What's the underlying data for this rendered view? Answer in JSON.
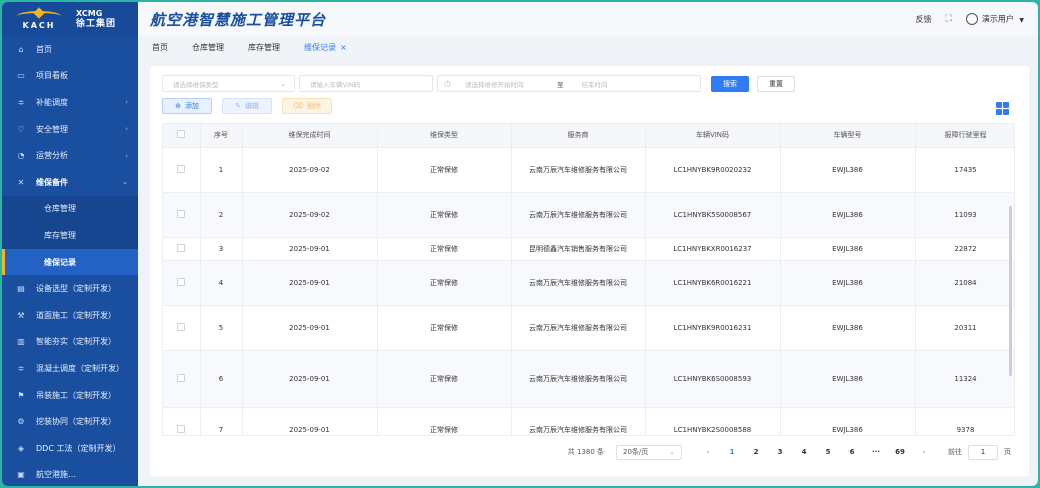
{
  "logo": {
    "left": "KACH",
    "right_en": "XCMG",
    "right_cn": "徐工集团"
  },
  "header": {
    "title": "航空港智慧施工管理平台",
    "feedback": "反馈",
    "fullscreen_icon": "⛶",
    "user": "演示用户"
  },
  "sidebar": {
    "items": [
      {
        "label": "首页",
        "icon": "⌂",
        "arrow": false
      },
      {
        "label": "项目看板",
        "icon": "▭",
        "arrow": false
      },
      {
        "label": "补能调度",
        "icon": "≑",
        "arrow": true
      },
      {
        "label": "安全管理",
        "icon": "♡",
        "arrow": true
      },
      {
        "label": "运营分析",
        "icon": "◔",
        "arrow": true
      },
      {
        "label": "维保备件",
        "icon": "✕",
        "arrow": true,
        "expanded": true
      },
      {
        "label": "仓库管理",
        "sub": true
      },
      {
        "label": "库存管理",
        "sub": true
      },
      {
        "label": "维保记录",
        "sub": true,
        "active": true
      },
      {
        "label": "设备选型（定制开发）",
        "icon": "▤"
      },
      {
        "label": "道面施工（定制开发）",
        "icon": "⚒"
      },
      {
        "label": "智能夯实（定制开发）",
        "icon": "▥"
      },
      {
        "label": "混凝土调度（定制开发）",
        "icon": "≑"
      },
      {
        "label": "吊装施工（定制开发）",
        "icon": "⚑"
      },
      {
        "label": "挖装协同（定制开发）",
        "icon": "⚙"
      },
      {
        "label": "DDC 工法（定制开发）",
        "icon": "◈"
      },
      {
        "label": "航空港施…",
        "icon": "▣"
      }
    ]
  },
  "tabs": [
    {
      "label": "首页"
    },
    {
      "label": "仓库管理"
    },
    {
      "label": "库存管理"
    },
    {
      "label": "维保记录",
      "active": true,
      "close": "×"
    }
  ],
  "filters": {
    "type_placeholder": "请选择维保类型",
    "vin_placeholder": "请输入车辆VIN码",
    "start_placeholder": "请选择维修开始时间",
    "range_sep": "至",
    "end_placeholder": "结束时间",
    "search": "搜索",
    "reset": "重置"
  },
  "actions": {
    "add": "添加",
    "edit": "编辑",
    "delete": "删除"
  },
  "table": {
    "columns": [
      "序号",
      "维保完成时间",
      "维保类型",
      "服务商",
      "车辆VIN码",
      "车辆型号",
      "报障行驶里程"
    ],
    "rows": [
      {
        "no": "1",
        "date": "2025-09-02",
        "type": "正常保修",
        "vendor": "云南万辰汽车维修服务有限公司",
        "vin": "LC1HNYBK9R0020232",
        "model": "EWJL386",
        "km": "17435"
      },
      {
        "no": "2",
        "date": "2025-09-02",
        "type": "正常保修",
        "vendor": "云南万辰汽车维修服务有限公司",
        "vin": "LC1HNYBK5S0008567",
        "model": "EWJL386",
        "km": "11093"
      },
      {
        "no": "3",
        "date": "2025-09-01",
        "type": "正常保修",
        "vendor": "昆明德鑫汽车销售服务有限公司",
        "vin": "LC1HNYBKXR0016237",
        "model": "EWJL386",
        "km": "22872"
      },
      {
        "no": "4",
        "date": "2025-09-01",
        "type": "正常保修",
        "vendor": "云南万辰汽车维修服务有限公司",
        "vin": "LC1HNYBK6R0016221",
        "model": "EWJL386",
        "km": "21084"
      },
      {
        "no": "5",
        "date": "2025-09-01",
        "type": "正常保修",
        "vendor": "云南万辰汽车维修服务有限公司",
        "vin": "LC1HNYBK9R0016231",
        "model": "EWJL386",
        "km": "20311"
      },
      {
        "no": "6",
        "date": "2025-09-01",
        "type": "正常保修",
        "vendor": "云南万辰汽车维修服务有限公司",
        "vin": "LC1HNYBK6S0008593",
        "model": "EWJL386",
        "km": "11324"
      },
      {
        "no": "7",
        "date": "2025-09-01",
        "type": "正常保修",
        "vendor": "云南万辰汽车维修服务有限公司",
        "vin": "LC1HNYBK2S0008588",
        "model": "EWJL386",
        "km": "9378"
      }
    ]
  },
  "pagination": {
    "total": "共 1380 条",
    "page_size": "20条/页",
    "prev": "‹",
    "next": "›",
    "pages": [
      "1",
      "2",
      "3",
      "4",
      "5",
      "6",
      "···",
      "69"
    ],
    "current": "1",
    "goto_label": "前往",
    "goto_value": "1",
    "goto_suffix": "页"
  }
}
